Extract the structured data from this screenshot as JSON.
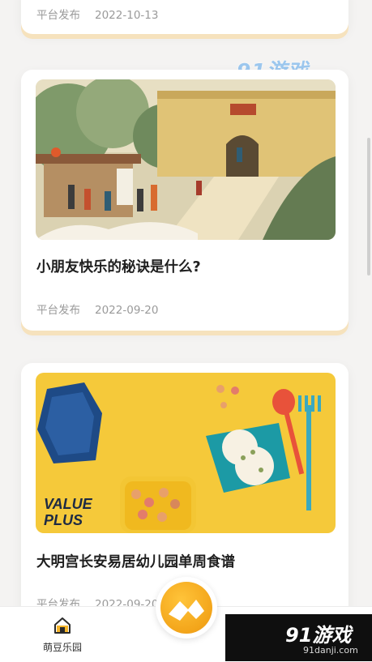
{
  "feed": {
    "cards": [
      {
        "title": "",
        "publisher": "平台发布",
        "date": "2022-10-13"
      },
      {
        "title": "小朋友快乐的秘诀是什么?",
        "publisher": "平台发布",
        "date": "2022-09-20",
        "image": "illustration-city-wall"
      },
      {
        "title": "大明宫长安易居幼儿园单周食谱",
        "publisher": "平台发布",
        "date": "2022-09-20",
        "image": "food-photo-icecream-cereal",
        "image_text": [
          "VALUE",
          "PLUS"
        ]
      }
    ]
  },
  "watermark": {
    "top": "91游戏",
    "bottom_big": "91游戏",
    "bottom_small": "91danji.com"
  },
  "bottom_nav": {
    "home_label": "萌豆乐园",
    "home_icon": "home-icon",
    "center_icon": "app-logo-icon"
  },
  "colors": {
    "accent": "#f3a51a",
    "card_shadow": "#f6e2bd",
    "background": "#f4f3f2"
  }
}
